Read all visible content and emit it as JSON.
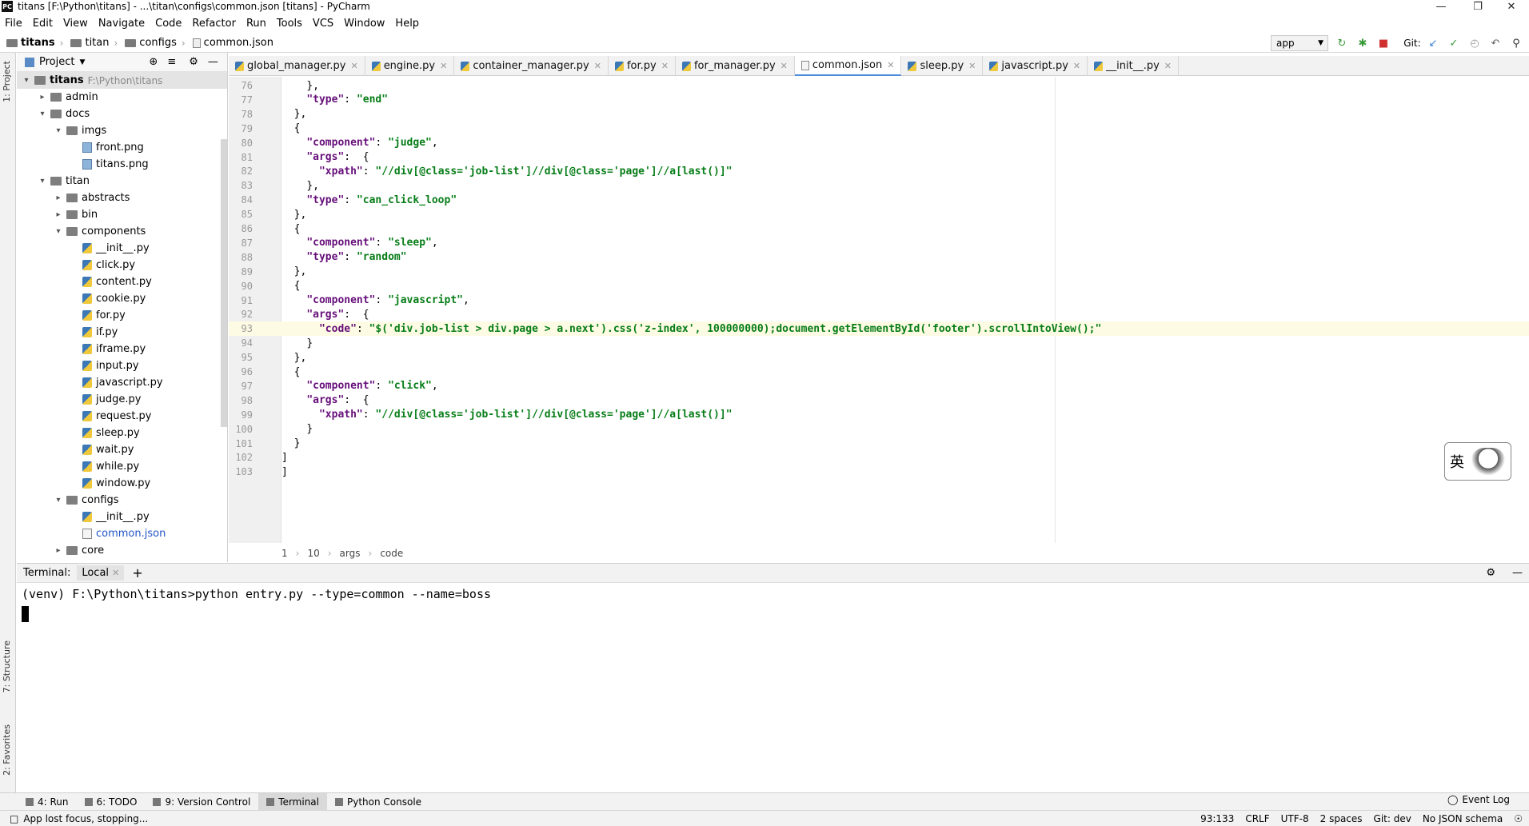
{
  "window": {
    "title": "titans [F:\\Python\\titans] - ...\\titan\\configs\\common.json [titans] - PyCharm",
    "app_icon": "PC"
  },
  "menu": [
    "File",
    "Edit",
    "View",
    "Navigate",
    "Code",
    "Refactor",
    "Run",
    "Tools",
    "VCS",
    "Window",
    "Help"
  ],
  "breadcrumb": [
    "titans",
    "titan",
    "configs",
    "common.json"
  ],
  "run_config": "app",
  "git_label": "Git:",
  "project_panel": {
    "title": "Project",
    "tree": [
      {
        "label": "titans",
        "note": "F:\\Python\\titans",
        "type": "folder",
        "expanded": true
      },
      {
        "label": "admin",
        "type": "folder",
        "expanded": false
      },
      {
        "label": "docs",
        "type": "folder",
        "expanded": true
      },
      {
        "label": "imgs",
        "type": "folder",
        "expanded": true
      },
      {
        "label": "front.png",
        "type": "image"
      },
      {
        "label": "titans.png",
        "type": "image"
      },
      {
        "label": "titan",
        "type": "folder",
        "expanded": true
      },
      {
        "label": "abstracts",
        "type": "folder",
        "expanded": false
      },
      {
        "label": "bin",
        "type": "folder",
        "expanded": false
      },
      {
        "label": "components",
        "type": "folder",
        "expanded": true
      },
      {
        "label": "__init__.py",
        "type": "py"
      },
      {
        "label": "click.py",
        "type": "py"
      },
      {
        "label": "content.py",
        "type": "py"
      },
      {
        "label": "cookie.py",
        "type": "py"
      },
      {
        "label": "for.py",
        "type": "py"
      },
      {
        "label": "if.py",
        "type": "py"
      },
      {
        "label": "iframe.py",
        "type": "py"
      },
      {
        "label": "input.py",
        "type": "py"
      },
      {
        "label": "javascript.py",
        "type": "py"
      },
      {
        "label": "judge.py",
        "type": "py"
      },
      {
        "label": "request.py",
        "type": "py"
      },
      {
        "label": "sleep.py",
        "type": "py"
      },
      {
        "label": "wait.py",
        "type": "py"
      },
      {
        "label": "while.py",
        "type": "py"
      },
      {
        "label": "window.py",
        "type": "py"
      },
      {
        "label": "configs",
        "type": "folder",
        "expanded": true
      },
      {
        "label": "__init__.py",
        "type": "py"
      },
      {
        "label": "common.json",
        "type": "json"
      },
      {
        "label": "core",
        "type": "folder",
        "expanded": false
      }
    ]
  },
  "tabs": [
    {
      "label": "global_manager.py",
      "type": "py"
    },
    {
      "label": "engine.py",
      "type": "py"
    },
    {
      "label": "container_manager.py",
      "type": "py"
    },
    {
      "label": "for.py",
      "type": "py"
    },
    {
      "label": "for_manager.py",
      "type": "py"
    },
    {
      "label": "common.json",
      "type": "json",
      "active": true
    },
    {
      "label": "sleep.py",
      "type": "py"
    },
    {
      "label": "javascript.py",
      "type": "py"
    },
    {
      "label": "__init__.py",
      "type": "py"
    }
  ],
  "editor": {
    "current_line": "93",
    "lines": [
      {
        "n": "76",
        "indent": "    ",
        "key": "",
        "val": "",
        "text": "},"
      },
      {
        "n": "77",
        "indent": "    ",
        "key": "\"type\"",
        "val": "\"end\"",
        "text": ""
      },
      {
        "n": "78",
        "indent": "  ",
        "key": "",
        "val": "",
        "text": "},"
      },
      {
        "n": "79",
        "indent": "  ",
        "key": "",
        "val": "",
        "text": "{"
      },
      {
        "n": "80",
        "indent": "    ",
        "key": "\"component\"",
        "val": "\"judge\"",
        "text": ","
      },
      {
        "n": "81",
        "indent": "    ",
        "key": "\"args\"",
        "val": "",
        "text": " {"
      },
      {
        "n": "82",
        "indent": "      ",
        "key": "\"xpath\"",
        "val": "\"//div[@class='job-list']//div[@class='page']//a[last()]\"",
        "text": ""
      },
      {
        "n": "83",
        "indent": "    ",
        "key": "",
        "val": "",
        "text": "},"
      },
      {
        "n": "84",
        "indent": "    ",
        "key": "\"type\"",
        "val": "\"can_click_loop\"",
        "text": ""
      },
      {
        "n": "85",
        "indent": "  ",
        "key": "",
        "val": "",
        "text": "},"
      },
      {
        "n": "86",
        "indent": "  ",
        "key": "",
        "val": "",
        "text": "{"
      },
      {
        "n": "87",
        "indent": "    ",
        "key": "\"component\"",
        "val": "\"sleep\"",
        "text": ","
      },
      {
        "n": "88",
        "indent": "    ",
        "key": "\"type\"",
        "val": "\"random\"",
        "text": ""
      },
      {
        "n": "89",
        "indent": "  ",
        "key": "",
        "val": "",
        "text": "},"
      },
      {
        "n": "90",
        "indent": "  ",
        "key": "",
        "val": "",
        "text": "{"
      },
      {
        "n": "91",
        "indent": "    ",
        "key": "\"component\"",
        "val": "\"javascript\"",
        "text": ","
      },
      {
        "n": "92",
        "indent": "    ",
        "key": "\"args\"",
        "val": "",
        "text": " {"
      },
      {
        "n": "93",
        "indent": "      ",
        "key": "\"code\"",
        "val": "\"$('div.job-list > div.page > a.next').css('z-index', 100000000);document.getElementById('footer').scrollIntoView();\"",
        "text": ""
      },
      {
        "n": "94",
        "indent": "    ",
        "key": "",
        "val": "",
        "text": "}"
      },
      {
        "n": "95",
        "indent": "  ",
        "key": "",
        "val": "",
        "text": "},"
      },
      {
        "n": "96",
        "indent": "  ",
        "key": "",
        "val": "",
        "text": "{"
      },
      {
        "n": "97",
        "indent": "    ",
        "key": "\"component\"",
        "val": "\"click\"",
        "text": ","
      },
      {
        "n": "98",
        "indent": "    ",
        "key": "\"args\"",
        "val": "",
        "text": " {"
      },
      {
        "n": "99",
        "indent": "      ",
        "key": "\"xpath\"",
        "val": "\"//div[@class='job-list']//div[@class='page']//a[last()]\"",
        "text": ""
      },
      {
        "n": "100",
        "indent": "    ",
        "key": "",
        "val": "",
        "text": "}"
      },
      {
        "n": "101",
        "indent": "  ",
        "key": "",
        "val": "",
        "text": "}"
      },
      {
        "n": "102",
        "indent": "",
        "key": "",
        "val": "",
        "text": "]"
      },
      {
        "n": "103",
        "indent": "",
        "key": "",
        "val": "",
        "text": "]"
      }
    ],
    "breadcrumb": [
      "1",
      "10",
      "args",
      "code"
    ]
  },
  "ime_widget": {
    "char": "英"
  },
  "terminal": {
    "label": "Terminal:",
    "tab": "Local",
    "prompt_line": "(venv) F:\\Python\\titans>python entry.py --type=common --name=boss"
  },
  "bottom_tools": [
    {
      "label": "4: Run"
    },
    {
      "label": "6: TODO"
    },
    {
      "label": "9: Version Control"
    },
    {
      "label": "Terminal",
      "active": true
    },
    {
      "label": "Python Console"
    }
  ],
  "event_log": "Event Log",
  "left_strip": {
    "project": "1: Project",
    "structure": "7: Structure",
    "favorites": "2: Favorites"
  },
  "status": {
    "message": "App lost focus, stopping...",
    "position": "93:133",
    "line_sep": "CRLF",
    "encoding": "UTF-8",
    "indent": "2 spaces",
    "vcs": "Git: dev",
    "schema": "No JSON schema"
  }
}
